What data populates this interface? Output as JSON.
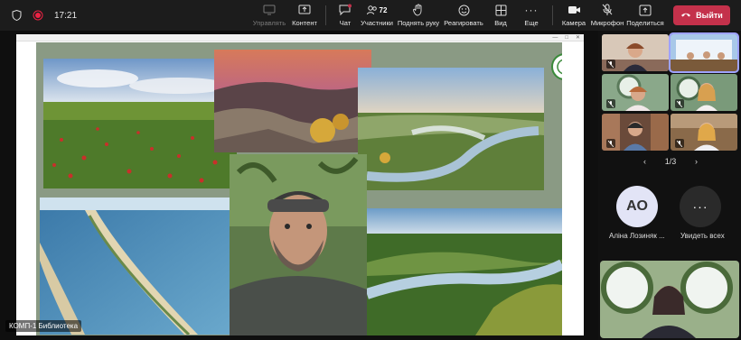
{
  "status": {
    "time": "17:21"
  },
  "toolbar": {
    "control_label": "Управлять",
    "content_label": "Контент",
    "chat_label": "Чат",
    "participants_label": "Участники",
    "participants_count": "72",
    "raise_hand_label": "Поднять руку",
    "react_label": "Реагировать",
    "view_label": "Вид",
    "more_label": "Еще",
    "camera_label": "Камера",
    "mic_label": "Микрофон",
    "share_label": "Поделиться",
    "leave_label": "Выйти"
  },
  "stage": {
    "caption": "КОМП-1 Библиотека"
  },
  "panel": {
    "pager": "1/3",
    "participant_initials": "АО",
    "participant_name": "Аліна Лозиняк ...",
    "see_all_label": "Увидеть всех"
  },
  "colors": {
    "leave": "#c4314b",
    "active_outline": "#9ea2ff",
    "bar": "#1c1c1c"
  }
}
